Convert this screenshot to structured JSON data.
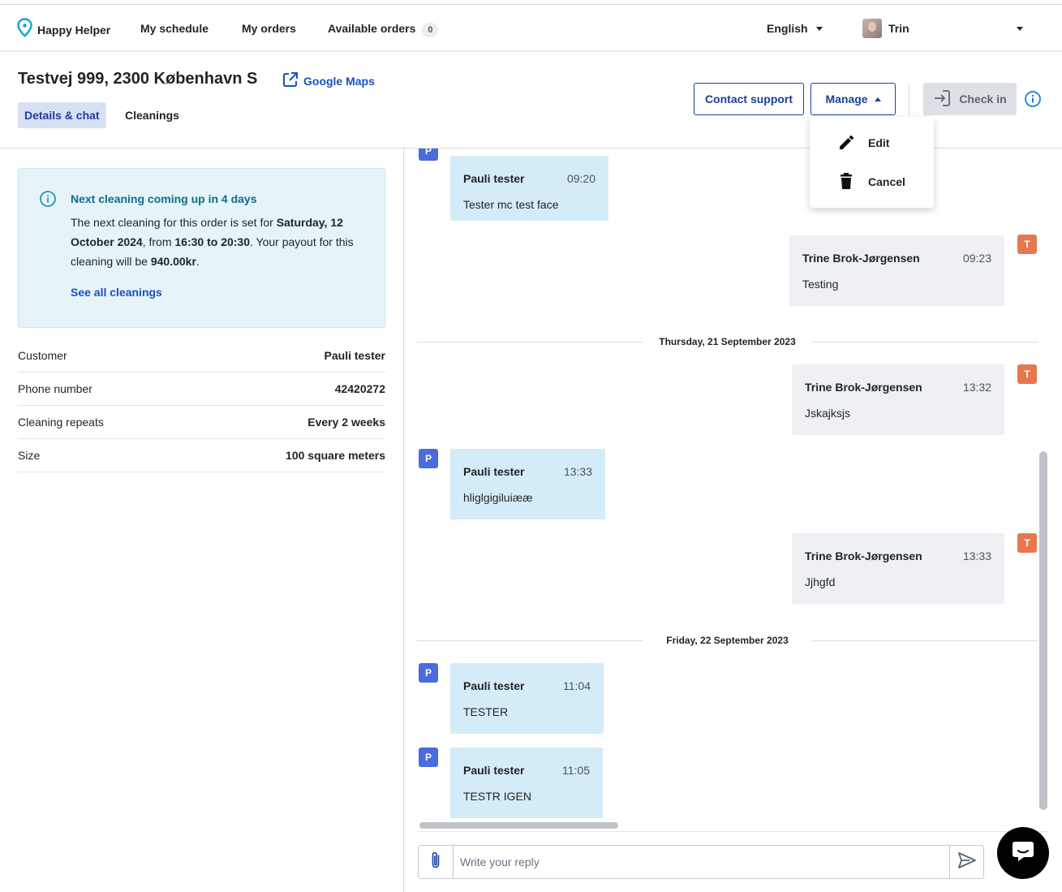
{
  "nav": {
    "brand": "Happy Helper",
    "links": [
      "My schedule",
      "My orders",
      "Available orders"
    ],
    "available_count": "0",
    "language": "English",
    "user": "Trin"
  },
  "header": {
    "title": "Testvej 999, 2300 København S",
    "maps_link": "Google Maps",
    "tabs": [
      "Details & chat",
      "Cleanings"
    ],
    "contact_support": "Contact support",
    "manage": "Manage",
    "check_in": "Check in"
  },
  "manage_menu": {
    "edit": "Edit",
    "cancel": "Cancel"
  },
  "notice": {
    "title": "Next cleaning coming up in 4 days",
    "t1": "The next cleaning for this order is set for ",
    "date": "Saturday, 12 October 2024",
    "t2": ", from ",
    "time": "16:30 to 20:30",
    "t3": ". Your payout for this cleaning will be ",
    "payout": "940.00kr",
    "t4": ".",
    "link": "See all cleanings"
  },
  "details": [
    {
      "label": "Customer",
      "value": "Pauli tester"
    },
    {
      "label": "Phone number",
      "value": "42420272"
    },
    {
      "label": "Cleaning repeats",
      "value": "Every 2 weeks"
    },
    {
      "label": "Size",
      "value": "100 square meters"
    }
  ],
  "chat": {
    "messages": [
      {
        "initial": "P",
        "name": "Pauli tester",
        "time": "09:20",
        "text": "Tester mc test face"
      },
      {
        "initial": "T",
        "name": "Trine Brok-Jørgensen",
        "time": "09:23",
        "text": "Testing"
      },
      {
        "initial": "T",
        "name": "Trine Brok-Jørgensen",
        "time": "13:32",
        "text": "Jskajksjs"
      },
      {
        "initial": "P",
        "name": "Pauli tester",
        "time": "13:33",
        "text": "hliglgigiluiææ"
      },
      {
        "initial": "T",
        "name": "Trine Brok-Jørgensen",
        "time": "13:33",
        "text": "Jjhgfd"
      },
      {
        "initial": "P",
        "name": "Pauli tester",
        "time": "11:04",
        "text": "TESTER"
      },
      {
        "initial": "P",
        "name": "Pauli tester",
        "time": "11:05",
        "text": "TESTR IGEN"
      }
    ],
    "day_separators": [
      "Thursday, 21 September 2023",
      "Friday, 22 September 2023"
    ]
  },
  "reply": {
    "placeholder": "Write your reply"
  },
  "colors": {
    "primary": "#1c3f9c",
    "link": "#1c4fc4",
    "pauli_avatar": "#4a6bdc",
    "trine_avatar": "#e5784f",
    "pauli_bubble": "#d3ecf7",
    "trine_bubble": "#eef0f3",
    "notice_bg": "#e6f4fa"
  },
  "icons": [
    "map-pin-icon",
    "external-link-icon",
    "pencil-icon",
    "trash-icon",
    "sign-in-icon",
    "info-icon",
    "paperclip-icon",
    "send-icon",
    "chat-bubble-icon"
  ]
}
